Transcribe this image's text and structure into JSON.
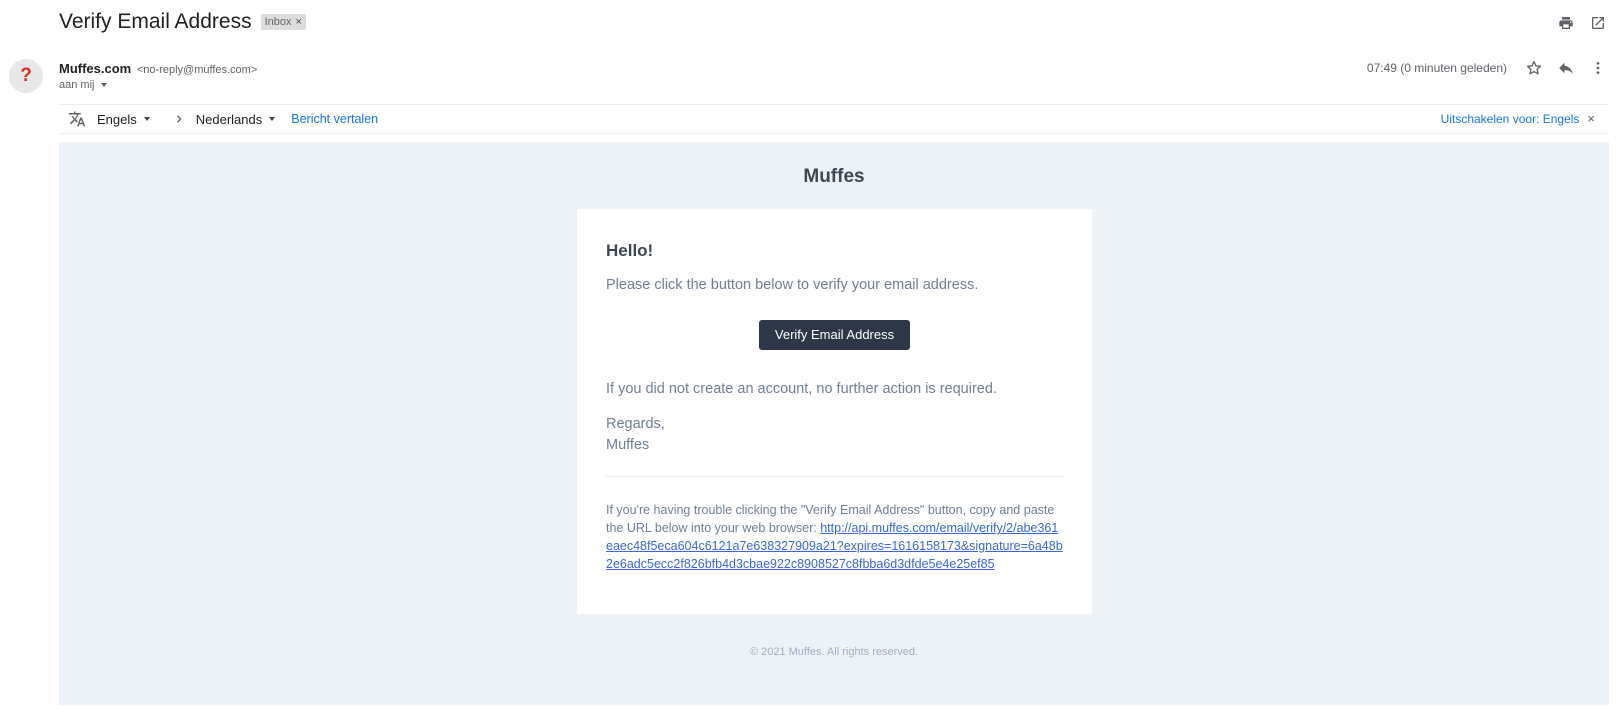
{
  "subject": {
    "title": "Verify Email Address",
    "label_chip": "Inbox",
    "chip_close": "×"
  },
  "sender": {
    "avatar_glyph": "?",
    "name": "Muffes.com",
    "email": "<no-reply@muffes.com>",
    "to": "aan mij",
    "timestamp": "07:49 (0 minuten geleden)"
  },
  "translate": {
    "source_lang": "Engels",
    "target_lang": "Nederlands",
    "translate_link": "Bericht vertalen",
    "disable_link": "Uitschakelen voor: Engels",
    "close": "×"
  },
  "email": {
    "brand": "Muffes",
    "greeting": "Hello!",
    "intro": "Please click the button below to verify your email address.",
    "button_label": "Verify Email Address",
    "outro": "If you did not create an account, no further action is required.",
    "regards": "Regards,",
    "signature": "Muffes",
    "subcopy_text": "If you're having trouble clicking the \"Verify Email Address\" button, copy and paste the URL below into your web browser: ",
    "subcopy_link": "http://api.muffes.com/email/verify/2/abe361eaec48f5eca604c6121a7e638327909a21?expires=1616158173&signature=6a48b2e6adc5ecc2f826bfb4d3cbae922c8908527c8fbba6d3dfde5e4e25ef85",
    "footer": "© 2021 Muffes. All rights reserved."
  },
  "icons": {
    "print": "print-icon",
    "open_new_window": "open-in-new-window-icon",
    "star": "star-icon",
    "reply": "reply-icon",
    "more": "more-vert-icon",
    "translate": "translate-icon",
    "arrow": "chevron-right-icon"
  },
  "colors": {
    "body_bg": "#edf2f7",
    "button_bg": "#2d3748",
    "link": "#3869d4",
    "gmail_link": "#1a73e8",
    "avatar_mark": "#d93025"
  }
}
